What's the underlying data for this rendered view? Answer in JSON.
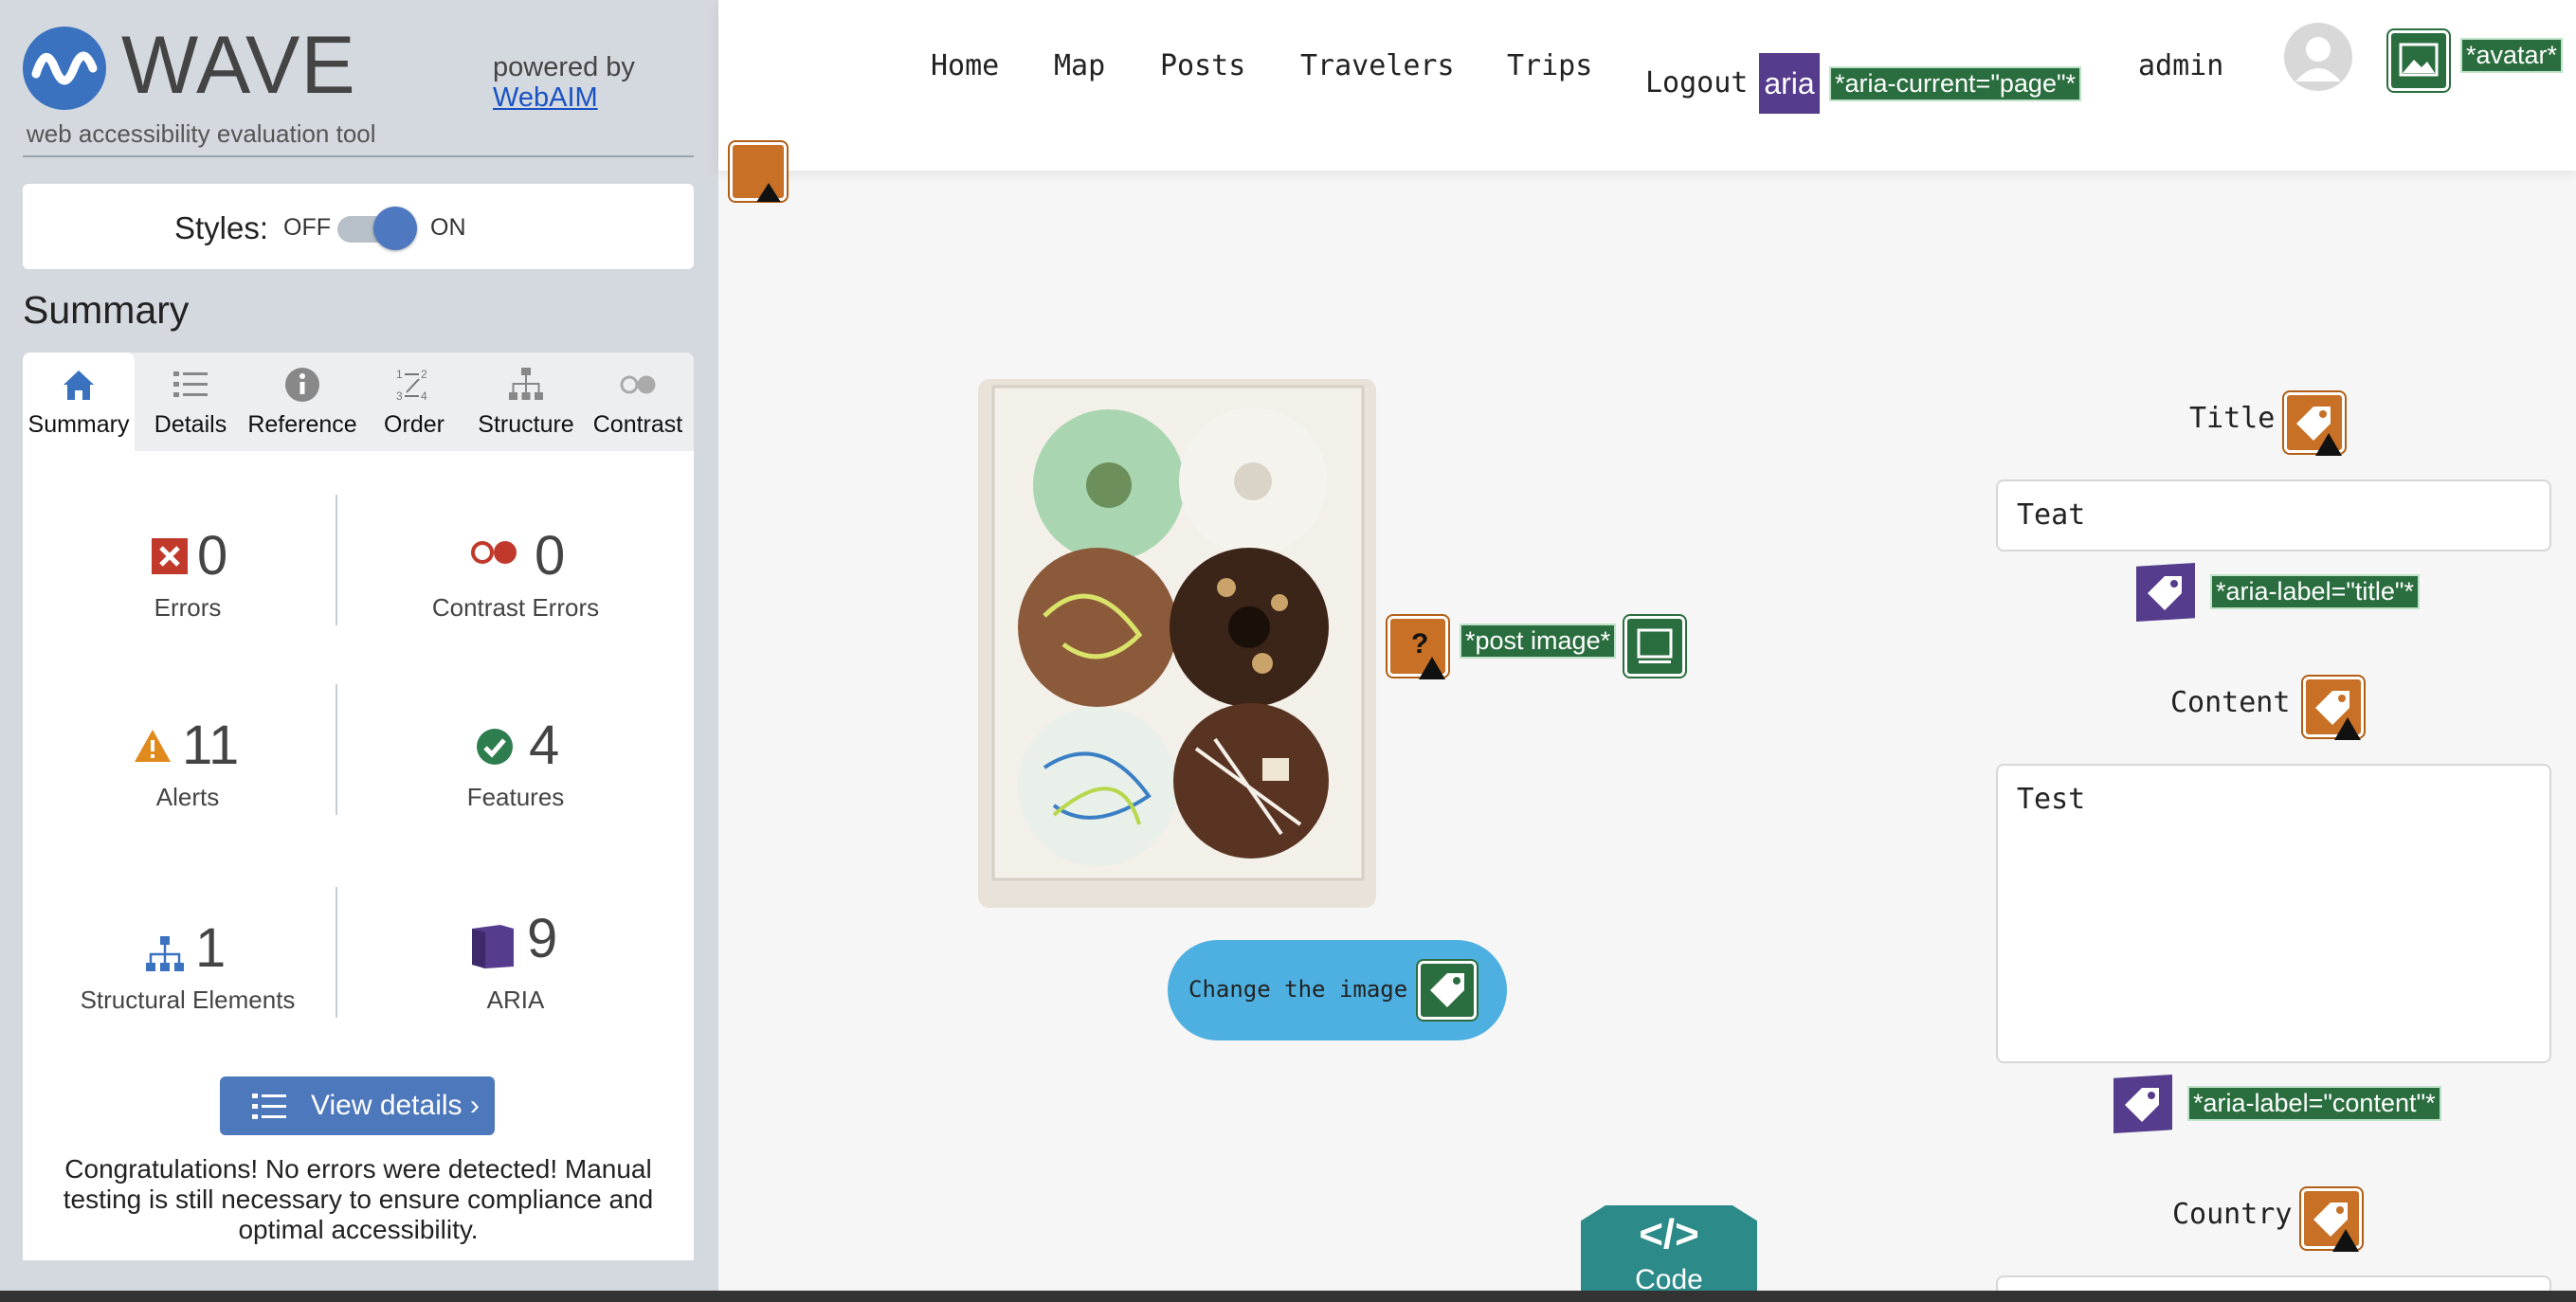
{
  "wave": {
    "logo_word": "WAVE",
    "subtitle": "web accessibility evaluation tool",
    "powered_by": "powered by",
    "powered_link": "WebAIM",
    "styles_label": "Styles:",
    "styles_off": "OFF",
    "styles_on": "ON",
    "summary_heading": "Summary",
    "tabs": [
      {
        "label": "Summary",
        "icon": "home-icon"
      },
      {
        "label": "Details",
        "icon": "list-icon"
      },
      {
        "label": "Reference",
        "icon": "info-icon"
      },
      {
        "label": "Order",
        "icon": "order-icon"
      },
      {
        "label": "Structure",
        "icon": "structure-icon"
      },
      {
        "label": "Contrast",
        "icon": "contrast-icon"
      }
    ],
    "stats": {
      "errors": {
        "value": "0",
        "label": "Errors",
        "color": "#c0392b"
      },
      "contrast_errors": {
        "value": "0",
        "label": "Contrast Errors",
        "color": "#c0392b"
      },
      "alerts": {
        "value": "11",
        "label": "Alerts",
        "color": "#e08a1e"
      },
      "features": {
        "value": "4",
        "label": "Features",
        "color": "#2e7d4f"
      },
      "structural": {
        "value": "1",
        "label": "Structural Elements",
        "color": "#3a72c0"
      },
      "aria": {
        "value": "9",
        "label": "ARIA",
        "color": "#553c8c"
      }
    },
    "view_details": "View details ›",
    "congrats": "Congratulations! No errors were detected! Manual testing is still necessary to ensure compliance and optimal accessibility."
  },
  "site": {
    "nav": [
      "Home",
      "Map",
      "Posts",
      "Travelers",
      "Trips"
    ],
    "logout": "Logout",
    "aria_badge": "aria",
    "aria_current_note": "*aria-current=\"page\"*",
    "admin": "admin",
    "avatar_note": "*avatar*",
    "post_image_note": "*post image*",
    "change_image": "Change the image",
    "title_label": "Title",
    "title_value": "Teat",
    "aria_label_title": "*aria-label=\"title\"*",
    "content_label": "Content",
    "content_value": "Test",
    "aria_label_content": "*aria-label=\"content\"*",
    "country_label": "Country",
    "code_glyph": "</>",
    "code_label": "Code"
  }
}
